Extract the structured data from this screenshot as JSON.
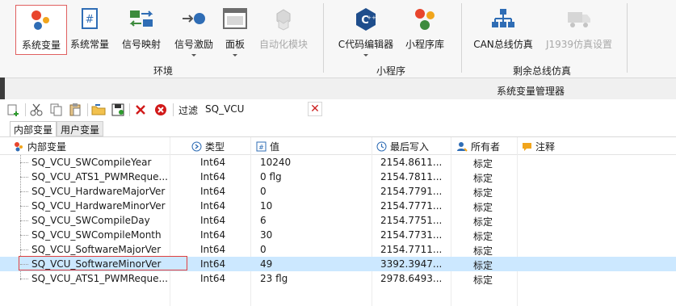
{
  "ribbon": {
    "buttons": [
      {
        "label": "系统变量",
        "icon": "system-variables-icon"
      },
      {
        "label": "系统常量",
        "icon": "system-constants-icon"
      },
      {
        "label": "信号映射",
        "icon": "signal-mapping-icon"
      },
      {
        "label": "信号激励",
        "icon": "signal-stimulus-icon"
      },
      {
        "label": "面板",
        "icon": "panel-icon"
      },
      {
        "label": "自动化模块",
        "icon": "automation-module-icon"
      },
      {
        "label": "C代码编辑器",
        "icon": "c-code-editor-icon"
      },
      {
        "label": "小程序库",
        "icon": "applet-library-icon"
      },
      {
        "label": "CAN总线仿真",
        "icon": "can-bus-simulation-icon"
      },
      {
        "label": "J1939仿真设置",
        "icon": "j1939-simulation-settings-icon"
      }
    ],
    "groups": [
      "环境",
      "小程序",
      "剩余总线仿真"
    ]
  },
  "status": {
    "title": "系统变量管理器"
  },
  "filter": {
    "label": "过滤",
    "value": "SQ_VCU"
  },
  "tabs": [
    "内部变量",
    "用户变量"
  ],
  "grid": {
    "headers": {
      "name": "内部变量",
      "type": "类型",
      "value": "值",
      "last_write": "最后写入",
      "owner": "所有者",
      "comment": "注释"
    },
    "rows": [
      {
        "name": "SQ_VCU_SWCompileYear",
        "type": "Int64",
        "value": "10240",
        "last_write": "2154.8611...",
        "owner": "标定"
      },
      {
        "name": "SQ_VCU_ATS1_PWMReque...",
        "type": "Int64",
        "value": "0 flg",
        "last_write": "2154.7811...",
        "owner": "标定"
      },
      {
        "name": "SQ_VCU_HardwareMajorVer",
        "type": "Int64",
        "value": "0",
        "last_write": "2154.7791...",
        "owner": "标定"
      },
      {
        "name": "SQ_VCU_HardwareMinorVer",
        "type": "Int64",
        "value": "10",
        "last_write": "2154.7771...",
        "owner": "标定"
      },
      {
        "name": "SQ_VCU_SWCompileDay",
        "type": "Int64",
        "value": "6",
        "last_write": "2154.7751...",
        "owner": "标定"
      },
      {
        "name": "SQ_VCU_SWCompileMonth",
        "type": "Int64",
        "value": "30",
        "last_write": "2154.7731...",
        "owner": "标定"
      },
      {
        "name": "SQ_VCU_SoftwareMajorVer",
        "type": "Int64",
        "value": "0",
        "last_write": "2154.7711...",
        "owner": "标定"
      },
      {
        "name": "SQ_VCU_SoftwareMinorVer",
        "type": "Int64",
        "value": "49",
        "last_write": "3392.3947...",
        "owner": "标定"
      },
      {
        "name": "SQ_VCU_ATS1_PWMReque...",
        "type": "Int64",
        "value": "23 flg",
        "last_write": "2978.6493...",
        "owner": "标定"
      }
    ],
    "selected_row": 7
  },
  "colors": {
    "accent_selected": "#cce8ff",
    "highlight_border": "#e04040"
  }
}
